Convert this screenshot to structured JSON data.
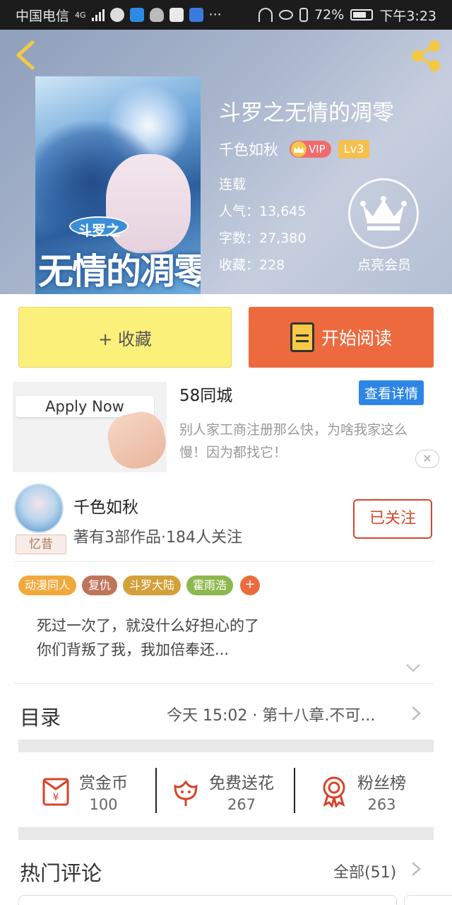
{
  "status_bar": {
    "carrier": "中国电信",
    "network": "4G",
    "more": "···",
    "battery": "72%",
    "time": "下午3:23"
  },
  "book": {
    "title": "斗罗之无情的凋零",
    "cover_tag": "斗罗之",
    "cover_title": "无情的凋零",
    "author": "千色如秋",
    "vip_label": "VIP",
    "level": "Lv3",
    "status": "连载",
    "popularity": "人气：13,645",
    "word_count": "字数：27,380",
    "favorites": "收藏：228",
    "member_label": "点亮会员"
  },
  "actions": {
    "collect_label": "+ 收藏",
    "read_label": "开始阅读"
  },
  "ad": {
    "image_text": "Apply Now",
    "title": "58同城",
    "detail_button": "查看详情",
    "description": "别人家工商注册那么快，为啥我家这么慢！因为都找它！",
    "close": "✕"
  },
  "author_card": {
    "name": "千色如秋",
    "info": "著有3部作品·184人关注",
    "avatar_tag": "忆昔",
    "follow_label": "已关注"
  },
  "tags": [
    {
      "label": "动漫同人",
      "color": "#f2a93b"
    },
    {
      "label": "复仇",
      "color": "#c0745a"
    },
    {
      "label": "斗罗大陆",
      "color": "#d3a13a"
    },
    {
      "label": "霍雨浩",
      "color": "#8cb84e"
    }
  ],
  "tag_more": "+",
  "summary": {
    "line1": "死过一次了，就没什么好担心的了",
    "line2": "你们背叛了我，我加倍奉还..."
  },
  "catalog": {
    "title": "目录",
    "latest": "今天 15:02 · 第十八章.不可..."
  },
  "stats": [
    {
      "label": "赏金币",
      "value": "100"
    },
    {
      "label": "免费送花",
      "value": "267"
    },
    {
      "label": "粉丝榜",
      "value": "263"
    }
  ],
  "comments": {
    "title": "热门评论",
    "all_label": "全部(51)"
  },
  "colors": {
    "accent_orange": "#ed6a3f",
    "collect_yellow": "#fbf07a",
    "follow_red": "#d2492e",
    "icon_red": "#d9432c"
  }
}
